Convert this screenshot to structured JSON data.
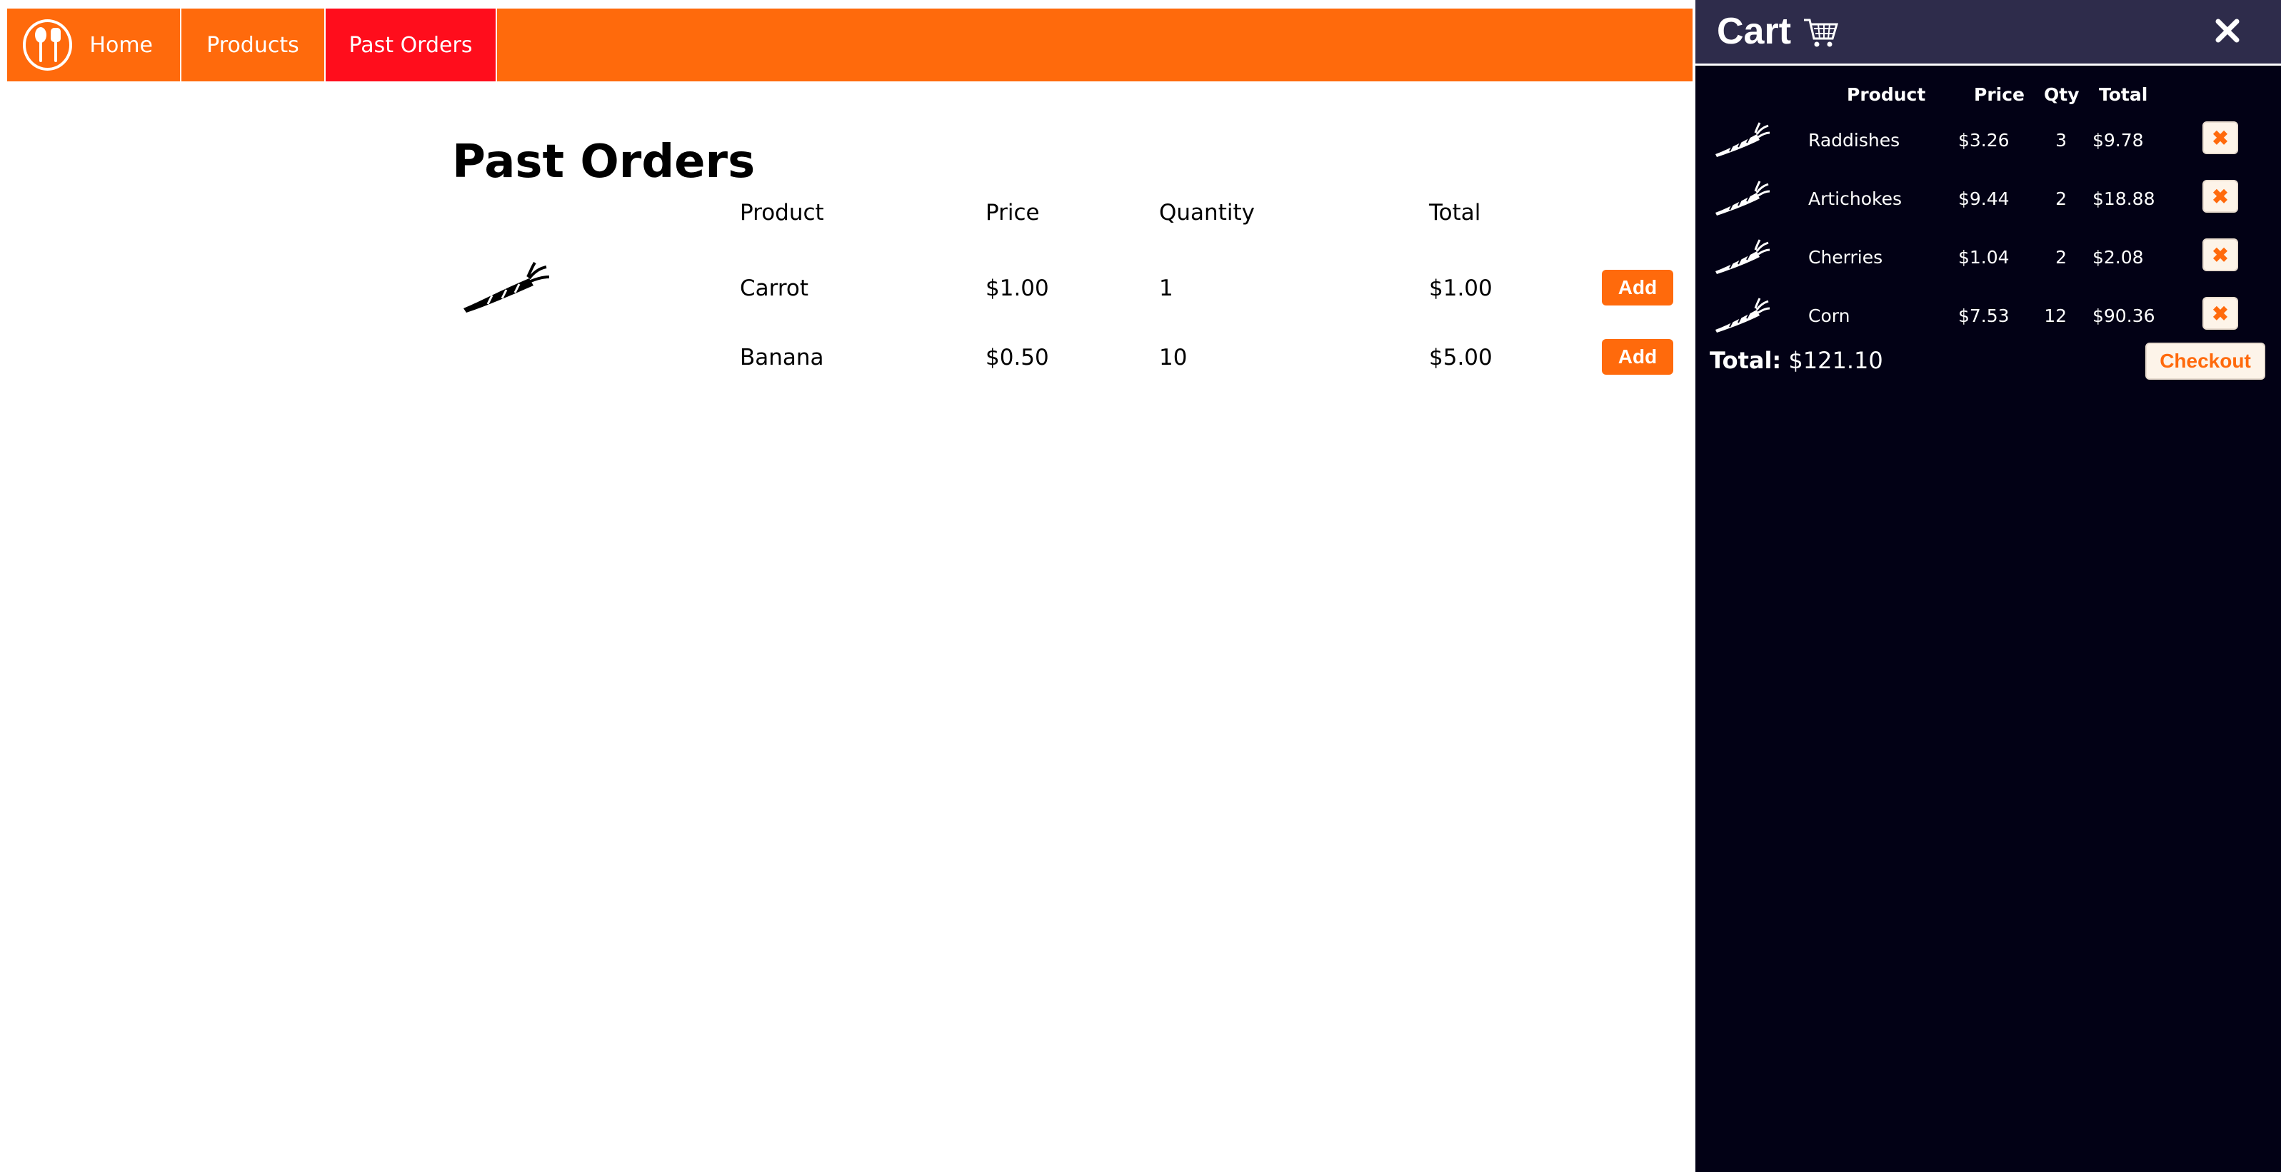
{
  "colors": {
    "accent": "#ff6a0c",
    "active_nav": "#ff0d1c",
    "cart_bg": "#020115",
    "cart_header_bg": "#2e2c4b"
  },
  "nav": {
    "logo_icon": "spoon-fork-logo-icon",
    "items": [
      {
        "label": "Home"
      },
      {
        "label": "Products"
      },
      {
        "label": "Past Orders",
        "active": true
      }
    ]
  },
  "main": {
    "title": "Past Orders",
    "columns": {
      "product": "Product",
      "price": "Price",
      "quantity": "Quantity",
      "total": "Total"
    },
    "rows": [
      {
        "product": "Carrot",
        "price": "$1.00",
        "quantity": "1",
        "total": "$1.00",
        "action": "Add",
        "icon": "carrot-icon"
      },
      {
        "product": "Banana",
        "price": "$0.50",
        "quantity": "10",
        "total": "$5.00",
        "action": "Add"
      }
    ]
  },
  "cart": {
    "title": "Cart",
    "cart_icon": "shopping-cart-icon",
    "close_icon": "close-icon",
    "columns": {
      "product": "Product",
      "price": "Price",
      "qty": "Qty",
      "total": "Total"
    },
    "items": [
      {
        "name": "Raddishes",
        "price": "$3.26",
        "qty": "3",
        "total": "$9.78",
        "remove": "✖"
      },
      {
        "name": "Artichokes",
        "price": "$9.44",
        "qty": "2",
        "total": "$18.88",
        "remove": "✖"
      },
      {
        "name": "Cherries",
        "price": "$1.04",
        "qty": "2",
        "total": "$2.08",
        "remove": "✖"
      },
      {
        "name": "Corn",
        "price": "$7.53",
        "qty": "12",
        "total": "$90.36",
        "remove": "✖"
      }
    ],
    "total_label": "Total:",
    "total_value": "$121.10",
    "checkout_label": "Checkout"
  }
}
